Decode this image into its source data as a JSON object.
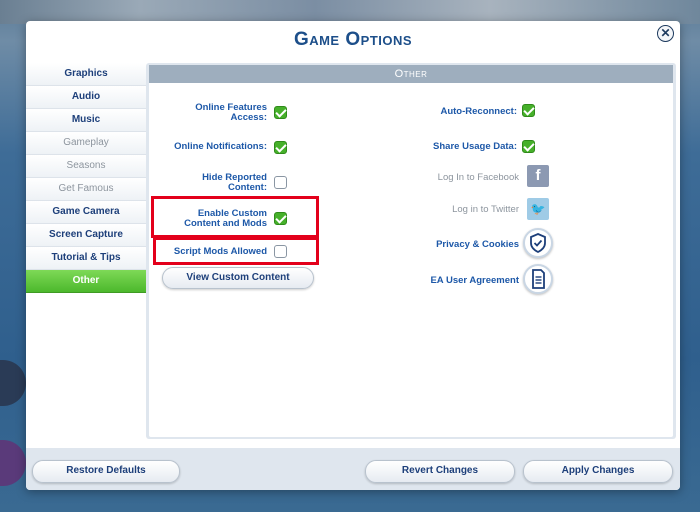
{
  "dialog": {
    "title": "Game Options",
    "close_symbol": "✕"
  },
  "sidebar": {
    "items": [
      {
        "label": "Graphics",
        "state": "normal"
      },
      {
        "label": "Audio",
        "state": "normal"
      },
      {
        "label": "Music",
        "state": "normal"
      },
      {
        "label": "Gameplay",
        "state": "disabled"
      },
      {
        "label": "Seasons",
        "state": "disabled"
      },
      {
        "label": "Get Famous",
        "state": "disabled"
      },
      {
        "label": "Game Camera",
        "state": "normal"
      },
      {
        "label": "Screen Capture",
        "state": "normal"
      },
      {
        "label": "Tutorial & Tips",
        "state": "normal"
      },
      {
        "label": "Other",
        "state": "active"
      }
    ]
  },
  "panel": {
    "header": "Other",
    "left_options": [
      {
        "label_line1": "Online Features",
        "label_line2": "Access:",
        "checked": true
      },
      {
        "label_line1": "Online Notifications:",
        "label_line2": "",
        "checked": true
      },
      {
        "label_line1": "Hide Reported",
        "label_line2": "Content:",
        "checked": false
      },
      {
        "label_line1": "Enable Custom",
        "label_line2": "Content and Mods",
        "checked": true
      },
      {
        "label_line1": "Script Mods Allowed",
        "label_line2": "",
        "checked": false
      }
    ],
    "view_custom_content": "View Custom Content",
    "right_options": [
      {
        "label": "Auto-Reconnect:",
        "checked": true
      },
      {
        "label": "Share Usage Data:",
        "checked": true
      }
    ],
    "social": {
      "facebook_label": "Log In to Facebook",
      "facebook_glyph": "f",
      "twitter_label": "Log in to Twitter",
      "twitter_glyph": "🐦"
    },
    "links": {
      "privacy": "Privacy & Cookies",
      "ea_agreement": "EA User Agreement"
    }
  },
  "footer": {
    "restore_defaults": "Restore Defaults",
    "revert_changes": "Revert Changes",
    "apply_changes": "Apply Changes"
  },
  "colors": {
    "accent_green": "#4cb82c",
    "title_blue": "#1d4f8a",
    "highlight_red": "#e3001b"
  }
}
